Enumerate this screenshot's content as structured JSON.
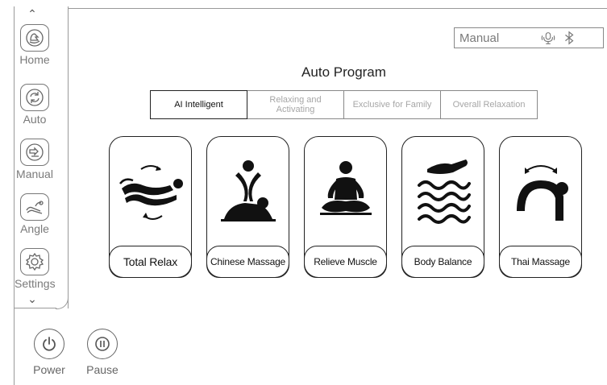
{
  "sidebar": {
    "items": [
      {
        "label": "Home",
        "icon": "home-hand-icon"
      },
      {
        "label": "Auto",
        "icon": "auto-cycle-icon"
      },
      {
        "label": "Manual",
        "icon": "manual-hand-icon"
      },
      {
        "label": "Angle",
        "icon": "angle-recline-icon"
      },
      {
        "label": "Settings",
        "icon": "settings-gear-icon"
      }
    ]
  },
  "controls": {
    "power_label": "Power",
    "pause_label": "Pause"
  },
  "status": {
    "mode_text": "Manual"
  },
  "page": {
    "title": "Auto Program"
  },
  "tabs": [
    {
      "label": "AI Intelligent",
      "active": true
    },
    {
      "label": "Relaxing and Activating",
      "active": false
    },
    {
      "label": "Exclusive for Family",
      "active": false
    },
    {
      "label": "Overall Relaxation",
      "active": false
    }
  ],
  "programs": [
    {
      "label": "Total Relax",
      "icon": "recline-body-icon"
    },
    {
      "label": "Chinese Massage",
      "icon": "chinese-massage-icon"
    },
    {
      "label": "Relieve Muscle",
      "icon": "meditation-icon"
    },
    {
      "label": "Body Balance",
      "icon": "waves-hand-icon"
    },
    {
      "label": "Thai Massage",
      "icon": "thai-stretch-icon"
    }
  ]
}
